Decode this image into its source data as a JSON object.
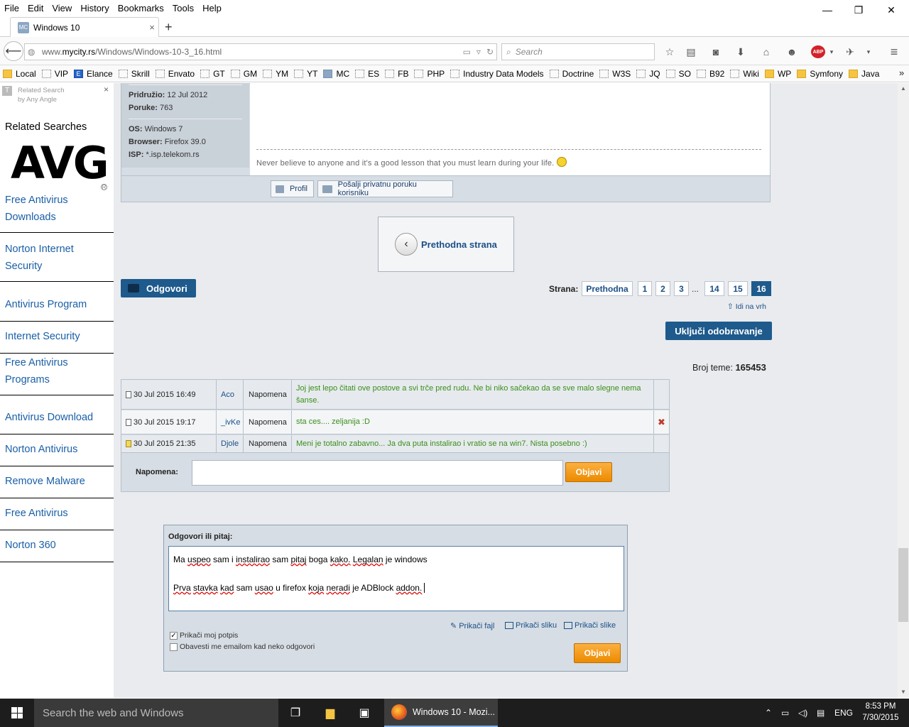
{
  "menu": [
    "File",
    "Edit",
    "View",
    "History",
    "Bookmarks",
    "Tools",
    "Help"
  ],
  "window_controls": {
    "minimize": "—",
    "restore": "❐",
    "close": "✕"
  },
  "tab": {
    "title": "Windows 10",
    "favicon": "MC",
    "close": "×"
  },
  "newtab": "+",
  "nav": {
    "url_prefix": "www.",
    "url_domain": "mycity.rs",
    "url_path": "/Windows/Windows-10-3_16.html",
    "search_placeholder": "Search"
  },
  "bookmarks": [
    {
      "label": "Local",
      "type": "folder"
    },
    {
      "label": "VIP",
      "type": "page"
    },
    {
      "label": "Elance",
      "type": "blue"
    },
    {
      "label": "Skrill",
      "type": "page"
    },
    {
      "label": "Envato",
      "type": "page"
    },
    {
      "label": "GT",
      "type": "page"
    },
    {
      "label": "GM",
      "type": "page"
    },
    {
      "label": "YM",
      "type": "page"
    },
    {
      "label": "YT",
      "type": "page"
    },
    {
      "label": "MC",
      "type": "mc"
    },
    {
      "label": "ES",
      "type": "page"
    },
    {
      "label": "FB",
      "type": "page"
    },
    {
      "label": "PHP",
      "type": "page"
    },
    {
      "label": "Industry Data Models",
      "type": "page"
    },
    {
      "label": "Doctrine",
      "type": "page"
    },
    {
      "label": "W3S",
      "type": "page"
    },
    {
      "label": "JQ",
      "type": "page"
    },
    {
      "label": "SO",
      "type": "page"
    },
    {
      "label": "B92",
      "type": "page"
    },
    {
      "label": "Wiki",
      "type": "page"
    },
    {
      "label": "WP",
      "type": "folder"
    },
    {
      "label": "Symfony",
      "type": "folder"
    },
    {
      "label": "Java",
      "type": "folder"
    }
  ],
  "bookmarks_overflow": "»",
  "sidebar": {
    "badge_line1": "Related Search",
    "badge_line2": "by Any Angle",
    "close": "×",
    "heading": "Related Searches",
    "logo": "AVG",
    "links": [
      "Free Antivirus Downloads",
      "Norton Internet Security",
      "Antivirus Program",
      "Internet Security",
      "Free Antivirus Programs",
      "Antivirus Download",
      "Norton Antivirus",
      "Remove Malware",
      "Free Antivirus",
      "Norton 360"
    ]
  },
  "post": {
    "pridruzio_label": "Pridružio:",
    "pridruzio": "12 Jul 2012",
    "poruke_label": "Poruke:",
    "poruke": "763",
    "os_label": "OS:",
    "os": "Windows 7",
    "browser_label": "Browser:",
    "browser": "Firefox 39.0",
    "isp_label": "ISP:",
    "isp": "*.isp.telekom.rs",
    "signature": "Never believe to anyone and it's a good lesson that you must learn during your life.",
    "btn_profil": "Profil",
    "btn_pm": "Pošalji privatnu poruku korisniku"
  },
  "prev_page": "Prethodna strana",
  "reply_button": "Odgovori",
  "pagination": {
    "label": "Strana:",
    "prev": "Prethodna",
    "pages": [
      "1",
      "2",
      "3",
      "14",
      "15",
      "16"
    ],
    "ellipsis": "...",
    "active": "16"
  },
  "idi_na_vrh": "⇧ Idi na vrh",
  "ukljuci": "Uključi odobravanje",
  "broj_teme_label": "Broj teme:",
  "broj_teme": "165453",
  "comments": [
    {
      "date": "30 Jul 2015 16:49",
      "user": "Aco",
      "type": "Napomena",
      "text": "Joj jest lepo čitati ove postove a svi trče pred rudu. Ne bi niko sačekao da se sve malo slegne nema šanse.",
      "delete": ""
    },
    {
      "date": "30 Jul 2015 19:17",
      "user": "_ivKe",
      "type": "Napomena",
      "text": "sta ces.... zeljanija :D",
      "delete": "✖"
    },
    {
      "date": "30 Jul 2015 21:35",
      "user": "Djole",
      "type": "Napomena",
      "text": "Meni je totalno zabavno... Ja dva puta instalirao i vratio se na win7. Nista posebno :)",
      "delete": ""
    }
  ],
  "napomena_label": "Napomena:",
  "objavi": "Objavi",
  "reply": {
    "label": "Odgovori ili pitaj:",
    "line1": "Ma uspeo sam i instalirao sam pitaj boga kako. Legalan je windows",
    "line2": "Prva stavka kad sam usao u firefox koja neradi je ADBlock addon.",
    "attach_file": "Prikači fajl",
    "attach_image": "Prikači sliku",
    "attach_images": "Prikači slike",
    "check_signature": "Prikači moj potpis",
    "check_email": "Obavesti me emailom kad neko odgovori",
    "submit": "Objavi"
  },
  "taskbar": {
    "search": "Search the web and Windows",
    "app": "Windows 10 - Mozi...",
    "lang": "ENG",
    "time": "8:53 PM",
    "date": "7/30/2015"
  },
  "colors": {
    "accent_blue": "#1e5a8c",
    "link_blue": "#1a5fa6",
    "comment_green": "#3b8f1a",
    "orange_button": "#ec8a00"
  }
}
